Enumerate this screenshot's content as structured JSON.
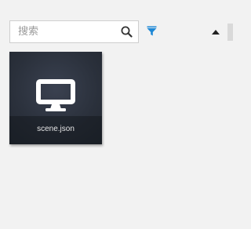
{
  "search": {
    "placeholder": "搜索",
    "value": ""
  },
  "toolbar": {
    "search_icon": "search-icon",
    "filter_icon": "filter-icon",
    "collapse_icon": "caret-up-icon",
    "filter_color": "#1e88d6"
  },
  "files": [
    {
      "name": "scene.json",
      "icon": "monitor-icon"
    }
  ]
}
